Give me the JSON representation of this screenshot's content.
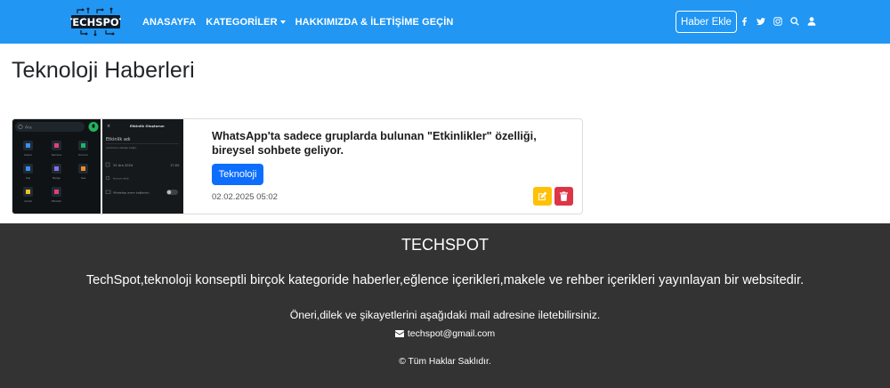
{
  "navbar": {
    "logo_text": "TECHSPOT",
    "links": [
      {
        "label": "ANASAYFA"
      },
      {
        "label": "KATEGORİLER"
      },
      {
        "label": "HAKKIMIZDA & İLETİŞİME GEÇİN"
      }
    ],
    "add_news_label": "Haber Ekle",
    "icons": [
      "facebook-icon",
      "twitter-icon",
      "instagram-icon",
      "search-icon",
      "user-icon"
    ],
    "background_color": "#2196f3"
  },
  "page": {
    "title": "Teknoloji Haberleri"
  },
  "news": [
    {
      "title": "WhatsApp'ta sadece gruplarda bulunan \"Etkinlikler\" özelliği, bireysel sohbete geliyor.",
      "category": "Teknoloji",
      "date": "02.02.2025 05:02",
      "thumbnail": {
        "search_placeholder": "Ara",
        "panel_title": "Etkinlik Oluşturun",
        "panel_field": "Etkinlik adı",
        "panel_desc": "Açıklama (isteğe bağlı)",
        "panel_date": "25 Ara 2024",
        "panel_time": "17:00",
        "panel_location": "Konum ekle",
        "panel_whatsapp": "WhatsApp aramı bağlantısı",
        "grid_labels": [
          "Galeri",
          "Kamera",
          "Konum",
          "Kişi",
          "Belge",
          "Ses",
          "Anket",
          "Etkinlik"
        ]
      },
      "edit_icon": "edit-icon",
      "delete_icon": "trash-icon"
    }
  ],
  "footer": {
    "title": "TECHSPOT",
    "description": "TechSpot,teknoloji konseptli birçok kategoride haberler,eğlence içerikleri,makele ve rehber içerikleri yayınlayan bir websitedir.",
    "contact_text": "Öneri,dilek ve şikayetlerini aşağıdaki mail adresine iletebilirsiniz.",
    "email": "techspot@gmail.com",
    "copyright": "© Tüm Haklar Saklıdır.",
    "background_color": "#333333"
  }
}
